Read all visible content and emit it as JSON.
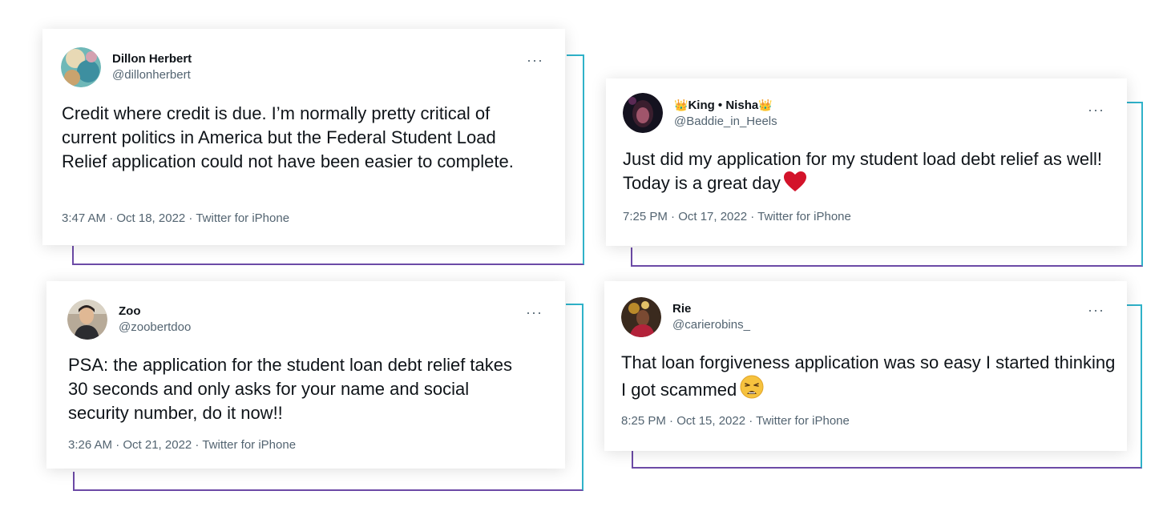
{
  "tweets": [
    {
      "name": "Dillon Herbert",
      "handle": "@dillonherbert",
      "text": "Credit where credit is due. I’m normally pretty critical of current politics in America but the Federal Student Load Relief application could not have been easier to complete.",
      "meta": "3:47 AM · Oct 18, 2022 · Twitter for iPhone",
      "more": "···"
    },
    {
      "name": "King • Nisha",
      "name_prefix": "👑",
      "name_suffix": "👑",
      "handle": "@Baddie_in_Heels",
      "text": "Just did my application for my student load debt relief as well! Today is a great day",
      "emoji": "heart-icon",
      "meta": "7:25 PM · Oct 17, 2022 · Twitter for iPhone",
      "more": "···"
    },
    {
      "name": "Zoo",
      "handle": "@zoobertdoo",
      "text": "PSA: the application for the student loan debt relief takes 30 seconds and only asks for your name and social security number, do it now!!",
      "meta": "3:26 AM · Oct 21, 2022 · Twitter for iPhone",
      "more": "···"
    },
    {
      "name": "Rie",
      "handle": "@carierobins_",
      "text": "That loan forgiveness application was so easy I started thinking I got scammed",
      "emoji": "weary-face-icon",
      "meta": "8:25 PM · Oct 15, 2022 · Twitter for iPhone",
      "more": "···"
    }
  ],
  "colors": {
    "frame_right": "#2fb2c9",
    "frame_bottom": "#6c4aa6",
    "text": "#0f1419",
    "muted": "#536471",
    "heart": "#d3132a"
  }
}
